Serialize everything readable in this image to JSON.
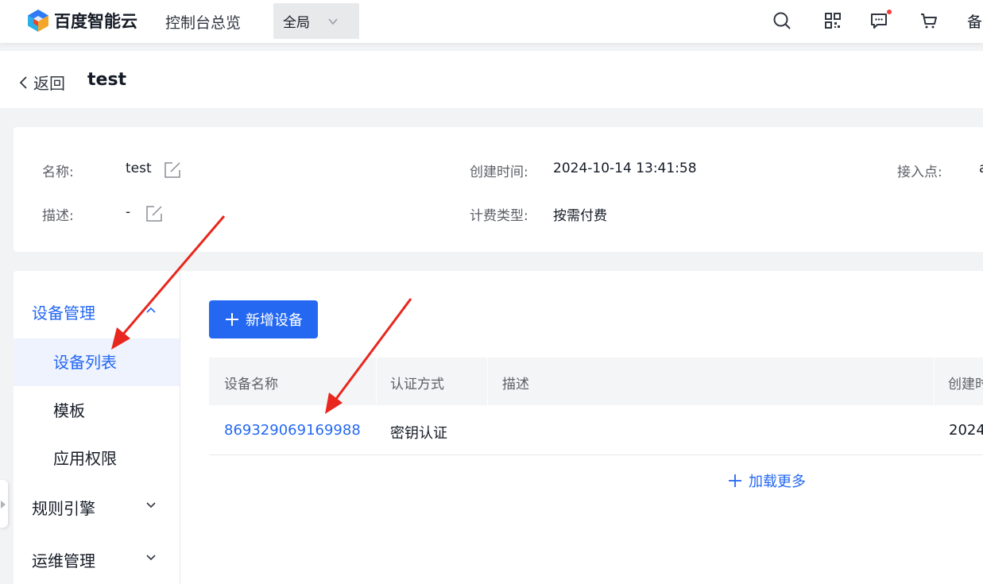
{
  "topbar": {
    "brand": "百度智能云",
    "console_title": "控制台总览",
    "region": "全局",
    "bei_text": "备",
    "icons": [
      "search-icon",
      "qrcode-icon",
      "message-icon",
      "cart-icon"
    ]
  },
  "header": {
    "back_label": "返回",
    "title": "test"
  },
  "info": {
    "name_label": "名称:",
    "name_value": "test",
    "desc_label": "描述:",
    "desc_value": "-",
    "created_label": "创建时间:",
    "created_value": "2024-10-14 13:41:58",
    "billing_label": "计费类型:",
    "billing_value": "按需付费",
    "endpoint_label": "接入点:",
    "endpoint_value": "a"
  },
  "sidebar": {
    "group_device": "设备管理",
    "items": [
      {
        "label": "设备列表"
      },
      {
        "label": "模板"
      },
      {
        "label": "应用权限"
      }
    ],
    "group_rules": "规则引擎",
    "group_ops": "运维管理"
  },
  "main": {
    "add_button": "新增设备",
    "columns": [
      "设备名称",
      "认证方式",
      "描述",
      "创建时"
    ],
    "rows": [
      {
        "name": "869329069169988",
        "auth": "密钥认证",
        "desc": "",
        "created": "2024"
      }
    ],
    "load_more": "加载更多"
  },
  "colors": {
    "accent": "#2468f2",
    "annotation_arrow": "#e8271e"
  }
}
